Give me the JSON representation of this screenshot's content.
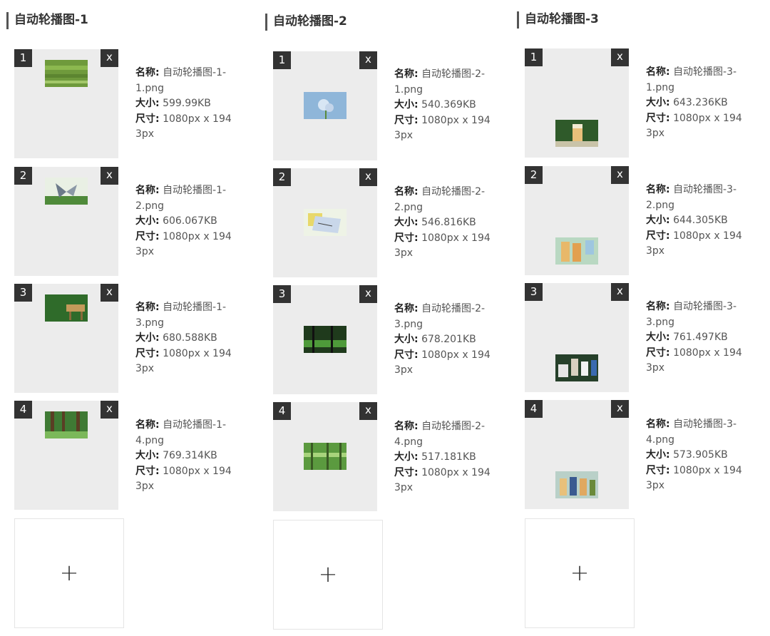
{
  "columns": [
    {
      "title": "自动轮播图-1",
      "items": [
        {
          "index": "1",
          "close": "x",
          "name_label": "名称:",
          "name": "自动轮播图-1-1.png",
          "size_label": "大小:",
          "size": "599.99KB",
          "dim_label": "尺寸:",
          "dim": "1080px x 1943px",
          "thumb": "green-grass-image"
        },
        {
          "index": "2",
          "close": "x",
          "name_label": "名称:",
          "name": "自动轮播图-1-2.png",
          "size_label": "大小:",
          "size": "606.067KB",
          "dim_label": "尺寸:",
          "dim": "1080px x 1943px",
          "thumb": "butterfly-image"
        },
        {
          "index": "3",
          "close": "x",
          "name_label": "名称:",
          "name": "自动轮播图-1-3.png",
          "size_label": "大小:",
          "size": "680.588KB",
          "dim_label": "尺寸:",
          "dim": "1080px x 1943px",
          "thumb": "forest-table-image"
        },
        {
          "index": "4",
          "close": "x",
          "name_label": "名称:",
          "name": "自动轮播图-1-4.png",
          "size_label": "大小:",
          "size": "769.314KB",
          "dim_label": "尺寸:",
          "dim": "1080px x 1943px",
          "thumb": "forest-trees-image"
        }
      ],
      "add_label": "+"
    },
    {
      "title": "自动轮播图-2",
      "items": [
        {
          "index": "1",
          "close": "x",
          "name_label": "名称:",
          "name": "自动轮播图-2-1.png",
          "size_label": "大小:",
          "size": "540.369KB",
          "dim_label": "尺寸:",
          "dim": "1080px x 1943px",
          "thumb": "flowers-sky-image"
        },
        {
          "index": "2",
          "close": "x",
          "name_label": "名称:",
          "name": "自动轮播图-2-2.png",
          "size_label": "大小:",
          "size": "546.816KB",
          "dim_label": "尺寸:",
          "dim": "1080px x 1943px",
          "thumb": "notebook-image"
        },
        {
          "index": "3",
          "close": "x",
          "name_label": "名称:",
          "name": "自动轮播图-2-3.png",
          "size_label": "大小:",
          "size": "678.201KB",
          "dim_label": "尺寸:",
          "dim": "1080px x 1943px",
          "thumb": "dark-forest-image"
        },
        {
          "index": "4",
          "close": "x",
          "name_label": "名称:",
          "name": "自动轮播图-2-4.png",
          "size_label": "大小:",
          "size": "517.181KB",
          "dim_label": "尺寸:",
          "dim": "1080px x 1943px",
          "thumb": "green-forest-image"
        }
      ],
      "add_label": "+"
    },
    {
      "title": "自动轮播图-3",
      "items": [
        {
          "index": "1",
          "close": "x",
          "name_label": "名称:",
          "name": "自动轮播图-3-1.png",
          "size_label": "大小:",
          "size": "643.236KB",
          "dim_label": "尺寸:",
          "dim": "1080px x 1943px",
          "thumb": "drink-cup-image"
        },
        {
          "index": "2",
          "close": "x",
          "name_label": "名称:",
          "name": "自动轮播图-3-2.png",
          "size_label": "大小:",
          "size": "644.305KB",
          "dim_label": "尺寸:",
          "dim": "1080px x 1943px",
          "thumb": "drinks-image"
        },
        {
          "index": "3",
          "close": "x",
          "name_label": "名称:",
          "name": "自动轮播图-3-3.png",
          "size_label": "大小:",
          "size": "761.497KB",
          "dim_label": "尺寸:",
          "dim": "1080px x 1943px",
          "thumb": "products-image"
        },
        {
          "index": "4",
          "close": "x",
          "name_label": "名称:",
          "name": "自动轮播图-3-4.png",
          "size_label": "大小:",
          "size": "573.905KB",
          "dim_label": "尺寸:",
          "dim": "1080px x 1943px",
          "thumb": "bottles-image"
        }
      ],
      "add_label": "+"
    }
  ]
}
